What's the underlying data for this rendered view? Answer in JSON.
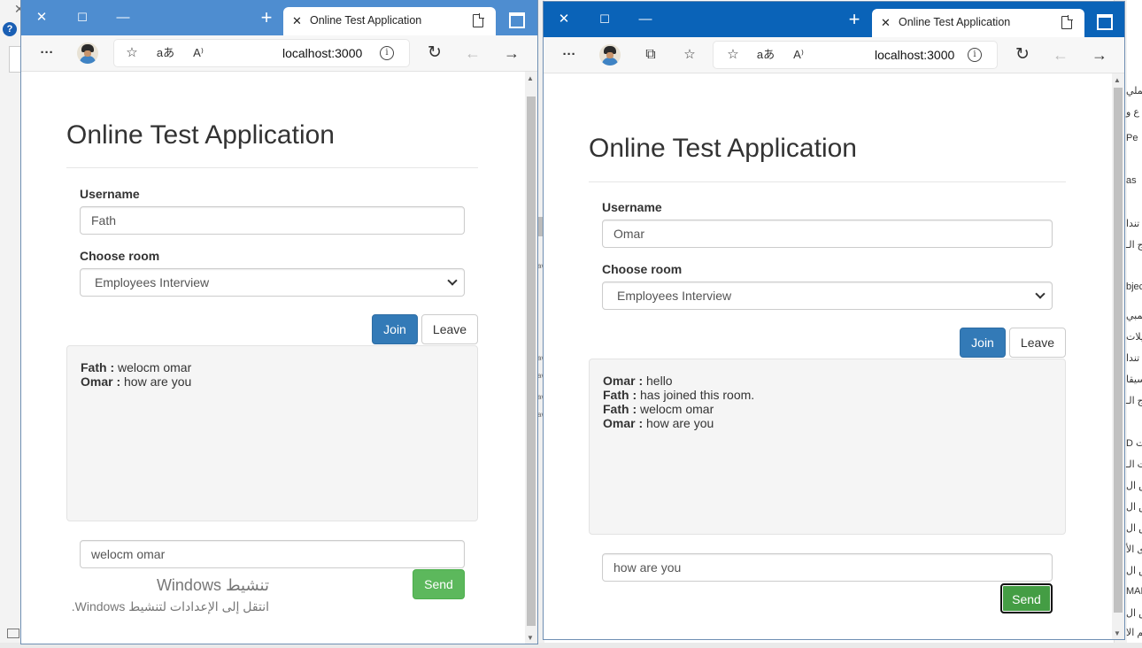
{
  "desktop": {
    "right_edge_fragments": [
      "عملي",
      "ع و",
      "Pe",
      "as",
      "تندا",
      "ج الـ",
      "bjec",
      "كمبي",
      "يلات",
      "تندا",
      "سيقا",
      "ج الـ",
      "D ت",
      "ت الـ",
      "س ال",
      "س ال",
      "س ال",
      "ى الأ",
      "س ال",
      "MAR",
      "س ال",
      "تم الا"
    ]
  },
  "left_window": {
    "tab_title": "Online Test Application",
    "url": "localhost:3000",
    "page": {
      "title": "Online Test Application",
      "username_label": "Username",
      "username_value": "Fath",
      "room_label": "Choose room",
      "room_selected": "Employees Interview",
      "join_label": "Join",
      "leave_label": "Leave",
      "messages": [
        {
          "user": "Fath :",
          "text": " welocm omar"
        },
        {
          "user": "Omar :",
          "text": " how are you"
        }
      ],
      "message_input": "welocm omar",
      "send_label": "Send"
    },
    "watermark": {
      "line1": "تنشيط Windows",
      "line2": "انتقل إلى الإعدادات لتنشيط Windows."
    }
  },
  "right_window": {
    "tab_title": "Online Test Application",
    "url": "localhost:3000",
    "page": {
      "title": "Online Test Application",
      "username_label": "Username",
      "username_value": "Omar",
      "room_label": "Choose room",
      "room_selected": "Employees Interview",
      "join_label": "Join",
      "leave_label": "Leave",
      "messages": [
        {
          "user": "Omar :",
          "text": " hello"
        },
        {
          "user": "Fath :",
          "text": " has joined this room."
        },
        {
          "user": "Fath :",
          "text": " welocm omar"
        },
        {
          "user": "Omar :",
          "text": " how are you"
        }
      ],
      "message_input": "how are you",
      "send_label": "Send"
    }
  },
  "icons": {
    "close": "close-icon",
    "maximize": "maximize-icon",
    "minimize": "minimize-icon",
    "new_tab": "plus-icon",
    "menu": "more-icon",
    "favorites": "star-icon",
    "translate": "translate-icon",
    "read_aloud": "read-aloud-icon",
    "refresh": "refresh-icon",
    "back": "back-arrow-icon",
    "forward": "forward-arrow-icon"
  },
  "colors": {
    "left_titlebar": "#4e8dd0",
    "right_titlebar": "#0a63b8",
    "primary": "#337ab7",
    "success": "#5cb85c"
  }
}
